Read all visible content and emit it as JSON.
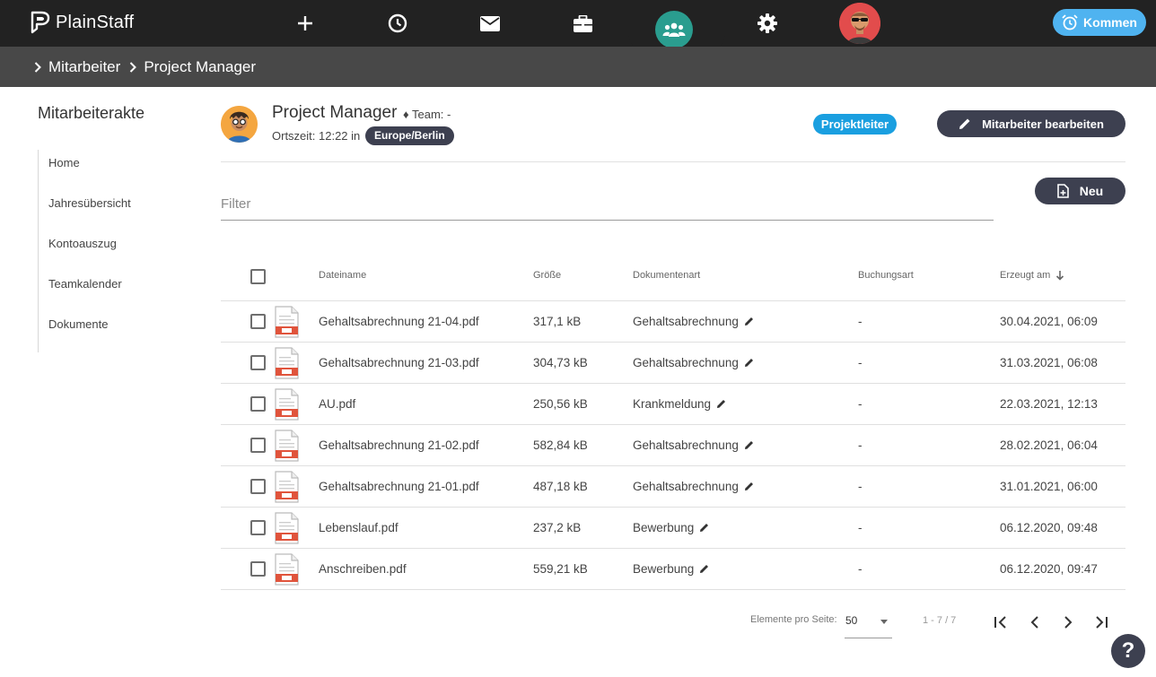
{
  "app": {
    "name": "PlainStaff"
  },
  "nav": {
    "items": [
      {
        "icon": "plus-icon"
      },
      {
        "icon": "clock-icon"
      },
      {
        "icon": "mail-icon"
      },
      {
        "icon": "briefcase-icon"
      },
      {
        "icon": "team-icon",
        "active": true
      },
      {
        "icon": "gear-icon"
      }
    ],
    "kommen_label": "Kommen",
    "accent": "#2a9d8f"
  },
  "breadcrumb": [
    "Mitarbeiter",
    "Project Manager"
  ],
  "sidebar": {
    "title": "Mitarbeiterakte",
    "items": [
      "Home",
      "Jahresübersicht",
      "Kontoauszug",
      "Teamkalender",
      "Dokumente"
    ]
  },
  "employee": {
    "name": "Project Manager",
    "team": "♦ Team: -",
    "local_time": "Ortszeit: 12:22 in",
    "timezone": "Europe/Berlin",
    "role": "Projektleiter",
    "edit_label": "Mitarbeiter bearbeiten"
  },
  "filter": {
    "placeholder": "Filter",
    "value": ""
  },
  "new_label": "Neu",
  "table": {
    "headers": {
      "filename": "Dateiname",
      "size": "Größe",
      "doctype": "Dokumentenart",
      "booking": "Buchungsart",
      "created": "Erzeugt am"
    },
    "rows": [
      {
        "filename": "Gehaltsabrechnung 21-04.pdf",
        "size": "317,1 kB",
        "doctype": "Gehaltsabrechnung",
        "booking": "-",
        "created": "30.04.2021, 06:09"
      },
      {
        "filename": "Gehaltsabrechnung 21-03.pdf",
        "size": "304,73 kB",
        "doctype": "Gehaltsabrechnung",
        "booking": "-",
        "created": "31.03.2021, 06:08"
      },
      {
        "filename": "AU.pdf",
        "size": "250,56 kB",
        "doctype": "Krankmeldung",
        "booking": "-",
        "created": "22.03.2021, 12:13"
      },
      {
        "filename": "Gehaltsabrechnung 21-02.pdf",
        "size": "582,84 kB",
        "doctype": "Gehaltsabrechnung",
        "booking": "-",
        "created": "28.02.2021, 06:04"
      },
      {
        "filename": "Gehaltsabrechnung 21-01.pdf",
        "size": "487,18 kB",
        "doctype": "Gehaltsabrechnung",
        "booking": "-",
        "created": "31.01.2021, 06:00"
      },
      {
        "filename": "Lebenslauf.pdf",
        "size": "237,2 kB",
        "doctype": "Bewerbung",
        "booking": "-",
        "created": "06.12.2020, 09:48"
      },
      {
        "filename": "Anschreiben.pdf",
        "size": "559,21 kB",
        "doctype": "Bewerbung",
        "booking": "-",
        "created": "06.12.2020, 09:47"
      }
    ]
  },
  "pager": {
    "label": "Elemente pro Seite:",
    "per_page": "50",
    "range": "1 - 7 / 7"
  },
  "help_label": "?"
}
